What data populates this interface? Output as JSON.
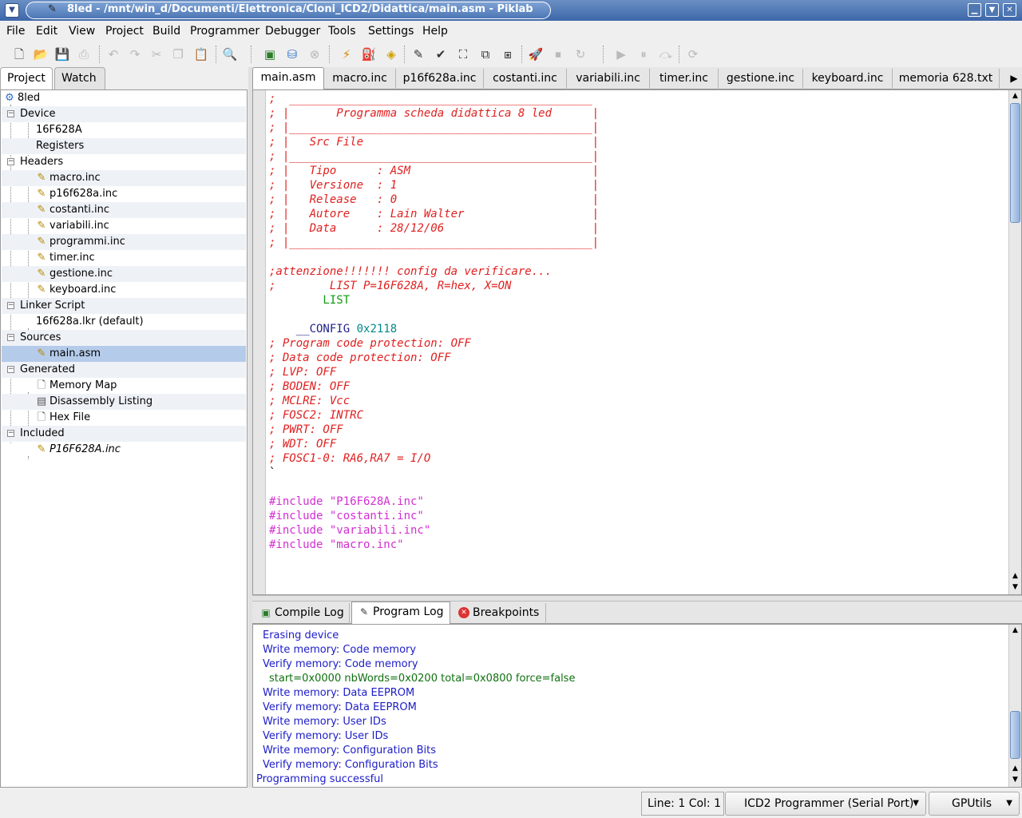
{
  "window": {
    "title": "8led - /mnt/win_d/Documenti/Elettronica/Cloni_ICD2/Didattica/main.asm - Piklab",
    "menu_icon": "chevron-down-icon",
    "minimize_glyph": "▁",
    "maximize_glyph": "▼",
    "close_glyph": "✕"
  },
  "menu": {
    "items": [
      "File",
      "Edit",
      "View",
      "Project",
      "Build",
      "Programmer",
      "Debugger",
      "Tools",
      "Settings",
      "Help"
    ]
  },
  "toolbar": {
    "icons": [
      "new-file-icon",
      "open-file-icon",
      "save-icon",
      "print-icon",
      "undo-icon",
      "redo-icon",
      "cut-icon",
      "copy-icon",
      "paste-icon",
      "find-icon",
      "build-file-icon",
      "build-project-icon",
      "stop-icon",
      "connect-icon",
      "erase-icon",
      "blank-check-icon",
      "program-icon",
      "verify-icon",
      "read-icon",
      "chip-icon",
      "chip-run-icon",
      "rocket-icon",
      "halt-icon",
      "reset-icon",
      "run-icon",
      "pause-icon",
      "step-icon",
      "restart-icon"
    ]
  },
  "left_panel": {
    "tabs": [
      "Project",
      "Watch"
    ],
    "tree": [
      {
        "label": "8led",
        "level": 0,
        "icon": "project-icon"
      },
      {
        "label": "Device",
        "level": 1,
        "icon": ""
      },
      {
        "label": "16F628A",
        "level": 2,
        "icon": ""
      },
      {
        "label": "Registers",
        "level": 2,
        "icon": ""
      },
      {
        "label": "Headers",
        "level": 1,
        "icon": ""
      },
      {
        "label": "macro.inc",
        "level": 2,
        "icon": "asm-file-icon"
      },
      {
        "label": "p16f628a.inc",
        "level": 2,
        "icon": "asm-file-icon"
      },
      {
        "label": "costanti.inc",
        "level": 2,
        "icon": "asm-file-icon"
      },
      {
        "label": "variabili.inc",
        "level": 2,
        "icon": "asm-file-icon"
      },
      {
        "label": "programmi.inc",
        "level": 2,
        "icon": "asm-file-icon"
      },
      {
        "label": "timer.inc",
        "level": 2,
        "icon": "asm-file-icon"
      },
      {
        "label": "gestione.inc",
        "level": 2,
        "icon": "asm-file-icon"
      },
      {
        "label": "keyboard.inc",
        "level": 2,
        "icon": "asm-file-icon"
      },
      {
        "label": "Linker Script",
        "level": 1,
        "icon": ""
      },
      {
        "label": "16f628a.lkr (default)",
        "level": 2,
        "icon": ""
      },
      {
        "label": "Sources",
        "level": 1,
        "icon": ""
      },
      {
        "label": "main.asm",
        "level": 2,
        "icon": "asm-file-icon"
      },
      {
        "label": "Generated",
        "level": 1,
        "icon": ""
      },
      {
        "label": "Memory Map",
        "level": 2,
        "icon": "document-icon"
      },
      {
        "label": "Disassembly Listing",
        "level": 2,
        "icon": "listing-icon"
      },
      {
        "label": "Hex File",
        "level": 2,
        "icon": "document-icon"
      },
      {
        "label": "Included",
        "level": 1,
        "icon": ""
      },
      {
        "label": "P16F628A.inc",
        "level": 2,
        "icon": "asm-file-icon"
      }
    ],
    "selected": "main.asm"
  },
  "editor": {
    "tabs": [
      "main.asm",
      "macro.inc",
      "p16f628a.inc",
      "costanti.inc",
      "variabili.inc",
      "timer.inc",
      "gestione.inc",
      "keyboard.inc",
      "memoria 628.txt"
    ],
    "active_tab": "main.asm",
    "lines": [
      {
        "t": ";  _____________________________________________",
        "c": "cmt"
      },
      {
        "t": "; |       Programma scheda didattica 8 led      |",
        "c": "cmt"
      },
      {
        "t": "; |_____________________________________________|",
        "c": "cmt"
      },
      {
        "t": "; |   Src File                                  |",
        "c": "cmt"
      },
      {
        "t": "; |_____________________________________________|",
        "c": "cmt"
      },
      {
        "t": "; |   Tipo      : ASM                           |",
        "c": "cmt"
      },
      {
        "t": "; |   Versione  : 1                             |",
        "c": "cmt"
      },
      {
        "t": "; |   Release   : 0                             |",
        "c": "cmt"
      },
      {
        "t": "; |   Autore    : Lain Walter                   |",
        "c": "cmt"
      },
      {
        "t": "; |   Data      : 28/12/06                      |",
        "c": "cmt"
      },
      {
        "t": "; |_____________________________________________|",
        "c": "cmt"
      },
      {
        "t": "",
        "c": ""
      },
      {
        "t": ";attenzione!!!!!!! config da verificare...",
        "c": "cmt"
      },
      {
        "t": ";        LIST P=16F628A, R=hex, X=ON",
        "c": "cmt"
      },
      {
        "t": "        LIST",
        "c": "dir"
      },
      {
        "t": "",
        "c": ""
      },
      {
        "t": "    __CONFIG 0x2118",
        "c": "config"
      },
      {
        "t": "; Program code protection: OFF",
        "c": "cmt"
      },
      {
        "t": "; Data code protection: OFF",
        "c": "cmt"
      },
      {
        "t": "; LVP: OFF",
        "c": "cmt"
      },
      {
        "t": "; BODEN: OFF",
        "c": "cmt"
      },
      {
        "t": "; MCLRE: Vcc",
        "c": "cmt"
      },
      {
        "t": "; FOSC2: INTRC",
        "c": "cmt"
      },
      {
        "t": "; PWRT: OFF",
        "c": "cmt"
      },
      {
        "t": "; WDT: OFF",
        "c": "cmt"
      },
      {
        "t": "; FOSC1-0: RA6,RA7 = I/O",
        "c": "cmt"
      },
      {
        "t": "`",
        "c": ""
      },
      {
        "t": "",
        "c": ""
      },
      {
        "t": "#include \"P16F628A.inc\"",
        "c": "inc"
      },
      {
        "t": "#include \"costanti.inc\"",
        "c": "inc"
      },
      {
        "t": "#include \"variabili.inc\"",
        "c": "inc"
      },
      {
        "t": "#include \"macro.inc\"",
        "c": "inc"
      },
      {
        "t": "",
        "c": ""
      },
      {
        "t": "",
        "c": ""
      },
      {
        "t": "",
        "c": ""
      },
      {
        "t": ";*****************************************************************************",
        "c": "cmt"
      }
    ],
    "config_keyword": "__CONFIG",
    "config_value": "0x2118"
  },
  "log": {
    "tabs": [
      {
        "label": "Compile Log",
        "icon": "compile-icon"
      },
      {
        "label": "Program Log",
        "icon": "program-icon"
      },
      {
        "label": "Breakpoints",
        "icon": "breakpoint-icon"
      }
    ],
    "active_tab": "Program Log",
    "lines": [
      {
        "t": "Erasing device",
        "c": "blue",
        "indent": 1
      },
      {
        "t": "Write memory: Code memory",
        "c": "blue",
        "indent": 1
      },
      {
        "t": "Verify memory: Code memory",
        "c": "blue",
        "indent": 1
      },
      {
        "t": "start=0x0000 nbWords=0x0200 total=0x0800 force=false",
        "c": "green",
        "indent": 2
      },
      {
        "t": "Write memory: Data EEPROM",
        "c": "blue",
        "indent": 1
      },
      {
        "t": "Verify memory: Data EEPROM",
        "c": "blue",
        "indent": 1
      },
      {
        "t": "Write memory: User IDs",
        "c": "blue",
        "indent": 1
      },
      {
        "t": "Verify memory: User IDs",
        "c": "blue",
        "indent": 1
      },
      {
        "t": "Write memory: Configuration Bits",
        "c": "blue",
        "indent": 1
      },
      {
        "t": "Verify memory: Configuration Bits",
        "c": "blue",
        "indent": 1
      },
      {
        "t": "Programming successful",
        "c": "blue",
        "indent": 0
      }
    ]
  },
  "status": {
    "position": "Line: 1  Col: 1",
    "programmer": "ICD2 Programmer (Serial Port)",
    "toolchain": "GPUtils"
  },
  "colors": {
    "titlebar": "#3d67a8",
    "comment": "#e02020",
    "include": "#d22fd2",
    "directive": "#119911",
    "log_blue": "#1c1cc8",
    "log_green": "#107010",
    "selection": "#b5cbea"
  }
}
